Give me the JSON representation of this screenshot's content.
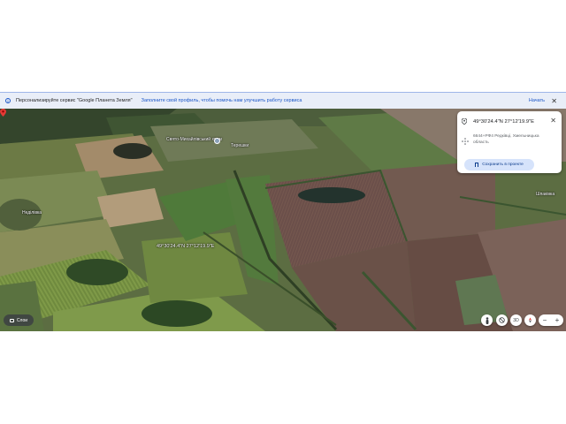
{
  "banner": {
    "title": "Персонализируйте сервис \"Google Планета Земля\"",
    "subtitle": "Заполните свой профиль, чтобы помочь нам улучшить работу сервиса",
    "start_label": "Начать",
    "close_icon": "close-icon"
  },
  "map": {
    "places": [
      {
        "name": "Свято-Михайлівський храм"
      },
      {
        "name": "Терешки"
      },
      {
        "name": "Неділівка"
      },
      {
        "name": "Шпаківка"
      }
    ],
    "marker_label": "49°30'24.4\"N 27°12'19.9\"E"
  },
  "card": {
    "coords": "49°30'24.4\"N 27°12'19.9\"E",
    "address_line1": "6644+РФ4 Редківці, Хмельницька",
    "address_line2": "область",
    "save_label": "Сохранить в проекте"
  },
  "controls": {
    "layers_label": "Слои",
    "view_2d": "3D",
    "zoom_out": "−",
    "zoom_in": "+"
  },
  "colors": {
    "accent": "#1a56c8",
    "banner_bg": "#e9eef8",
    "pin": "#e53935"
  }
}
